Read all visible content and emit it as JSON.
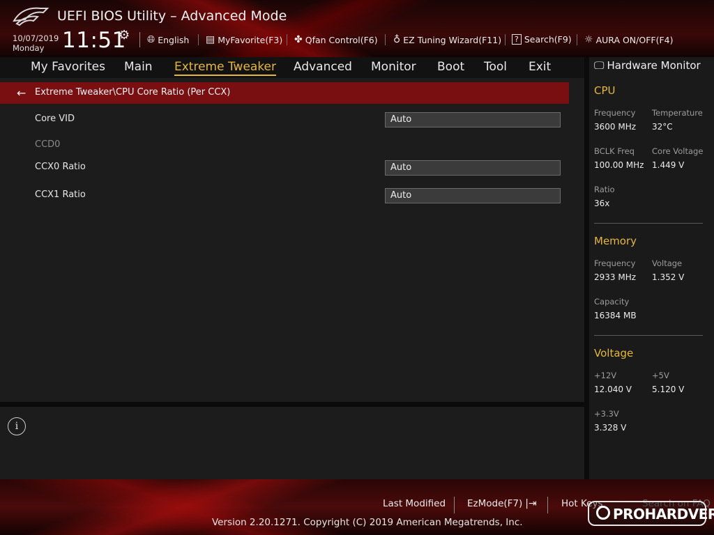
{
  "header": {
    "title": "UEFI BIOS Utility – Advanced Mode",
    "date": "10/07/2019",
    "day": "Monday",
    "time": "11:51",
    "items": [
      {
        "label": "English",
        "icon": "globe-icon"
      },
      {
        "label": "MyFavorite(F3)",
        "icon": "favorite-list-icon"
      },
      {
        "label": "Qfan Control(F6)",
        "icon": "fan-icon"
      },
      {
        "label": "EZ Tuning Wizard(F11)",
        "icon": "lightbulb-icon"
      },
      {
        "label": "Search(F9)",
        "icon": "search-help-icon"
      },
      {
        "label": "AURA ON/OFF(F4)",
        "icon": "aura-light-icon"
      }
    ]
  },
  "menu": {
    "tabs": [
      "My Favorites",
      "Main",
      "Extreme Tweaker",
      "Advanced",
      "Monitor",
      "Boot",
      "Tool",
      "Exit"
    ],
    "active": "Extreme Tweaker"
  },
  "breadcrumb": "Extreme Tweaker\\CPU Core Ratio (Per CCX)",
  "settings": {
    "core_vid": {
      "label": "Core VID",
      "value": "Auto"
    },
    "ccd0": "CCD0",
    "ccx0": {
      "label": "CCX0 Ratio",
      "value": "Auto"
    },
    "ccx1": {
      "label": "CCX1 Ratio",
      "value": "Auto"
    }
  },
  "hardware_monitor": {
    "title": "Hardware Monitor",
    "cpu": {
      "heading": "CPU",
      "frequency_label": "Frequency",
      "frequency": "3600 MHz",
      "temperature_label": "Temperature",
      "temperature": "32°C",
      "bclk_label": "BCLK Freq",
      "bclk": "100.00 MHz",
      "core_voltage_label": "Core Voltage",
      "core_voltage": "1.449 V",
      "ratio_label": "Ratio",
      "ratio": "36x"
    },
    "memory": {
      "heading": "Memory",
      "frequency_label": "Frequency",
      "frequency": "2933 MHz",
      "voltage_label": "Voltage",
      "voltage": "1.352 V",
      "capacity_label": "Capacity",
      "capacity": "16384 MB"
    },
    "voltage": {
      "heading": "Voltage",
      "v12_label": "+12V",
      "v12": "12.040 V",
      "v5_label": "+5V",
      "v5": "5.120 V",
      "v33_label": "+3.3V",
      "v33": "3.328 V"
    }
  },
  "footer": {
    "last_modified": "Last Modified",
    "ezmode": "EzMode(F7)",
    "hotkeys": "Hot Keys",
    "search_faq": "Search on FAQ",
    "version": "Version 2.20.1271. Copyright (C) 2019 American Megatrends, Inc.",
    "watermark": "PROHARDVER!"
  },
  "colors": {
    "accent": "#e6b73b",
    "breadcrumb_bg": "#7a0f12",
    "brand_red": "#a00d12"
  }
}
